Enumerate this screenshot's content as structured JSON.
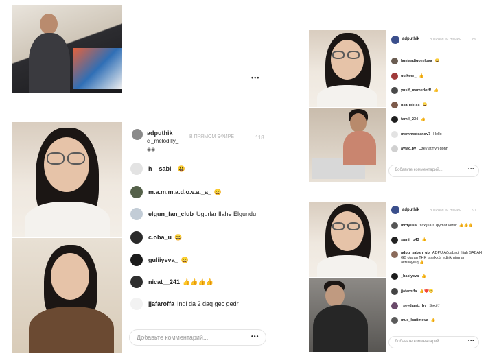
{
  "stream_main": {
    "host": "adputhik",
    "live_label": "В ПРЯМОМ ЭФИРЕ",
    "viewers": "118",
    "with_label": "с _melodilly_",
    "comments": [
      {
        "user": "h__sabi_",
        "text": "😀"
      },
      {
        "user": "m.a.m.m.a.d.o.v.a._a_",
        "text": "😀"
      },
      {
        "user": "elgun_fan_club",
        "text": "Ugurlar Ilahe Elgundu"
      },
      {
        "user": "c.oba_u",
        "text": "😀"
      },
      {
        "user": "guliiyeva_",
        "text": "😀"
      },
      {
        "user": "nicat__241",
        "text": "👍👍👍👍"
      },
      {
        "user": "jjafaroffa",
        "text": "Indi da 2 daq gec gedr"
      }
    ],
    "comment_placeholder": "Добавьте комментарий...",
    "more": "•••"
  },
  "stream_top_right": {
    "host": "adputhik",
    "live_label": "В ПРЯМОМ ЭФИРЕ",
    "viewers": "89",
    "comments": [
      {
        "user": "lamiaadigozelova",
        "text": "😀"
      },
      {
        "user": "uulkeer_",
        "text": "👍"
      },
      {
        "user": "yusif_mamedofff",
        "text": "👍"
      },
      {
        "user": "nsarminss",
        "text": "😀"
      },
      {
        "user": "famil_234",
        "text": "👍"
      },
      {
        "user": "memmedcanov7",
        "text": "Hello"
      },
      {
        "user": "aytac.bv",
        "text": "Uzey atmyn donn"
      }
    ],
    "comment_placeholder": "Добавьте комментарий...",
    "more": "•••"
  },
  "stream_bottom_right": {
    "host": "adputhik",
    "live_label": "В ПРЯМОМ ЭФИРЕ",
    "viewers": "91",
    "comments": [
      {
        "user": "mrdyusa",
        "text": "Yaxşılara qiymət verilir. 👍👍👍"
      },
      {
        "user": "samil_o43",
        "text": "👍"
      },
      {
        "user": "adpu_sabah_gb",
        "text": "ADPU Ağcabədi filialı SABAH GB olaraq THK təşəkkür edirik uğurlar arzulayırıq 👍"
      },
      {
        "user": "_haciyeva",
        "text": "👍"
      },
      {
        "user": "jjafaroffa",
        "text": "👍❤️😀"
      },
      {
        "user": "_sevdamiz_by",
        "text": "Şəki♡"
      },
      {
        "user": "mus_kadimova",
        "text": "👍"
      }
    ],
    "comment_placeholder": "Добавьте комментарий...",
    "more": "•••"
  },
  "top_post": {
    "more": "•••"
  }
}
